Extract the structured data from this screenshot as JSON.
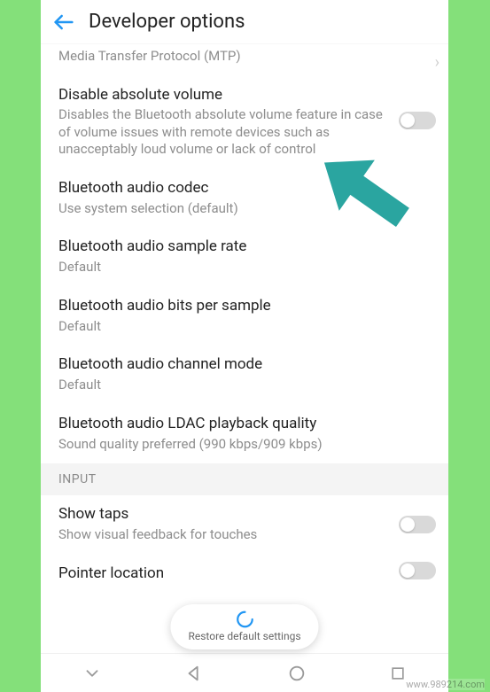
{
  "colors": {
    "accent": "#2aa5a0",
    "arrow_fill": "#2aa5a0",
    "bg": "#84e07a"
  },
  "appbar": {
    "title": "Developer options"
  },
  "rows": {
    "usb_config": {
      "title": "",
      "sub": "Media Transfer Protocol (MTP)"
    },
    "abs_volume": {
      "title": "Disable absolute volume",
      "sub": "Disables the Bluetooth absolute volume feature in case of volume issues with remote devices such as unacceptably loud volume or lack of control"
    },
    "codec": {
      "title": "Bluetooth audio codec",
      "sub": "Use system selection (default)"
    },
    "sample_rate": {
      "title": "Bluetooth audio sample rate",
      "sub": "Default"
    },
    "bits": {
      "title": "Bluetooth audio bits per sample",
      "sub": "Default"
    },
    "channel": {
      "title": "Bluetooth audio channel mode",
      "sub": "Default"
    },
    "ldac": {
      "title": "Bluetooth audio LDAC playback quality",
      "sub": "Sound quality preferred (990 kbps/909 kbps)"
    }
  },
  "section_input": "INPUT",
  "input_rows": {
    "show_taps": {
      "title": "Show taps",
      "sub": "Show visual feedback for touches"
    },
    "pointer": {
      "title": "Pointer location"
    }
  },
  "pill": {
    "label": "Restore default settings"
  },
  "watermark": "www.989214.com"
}
